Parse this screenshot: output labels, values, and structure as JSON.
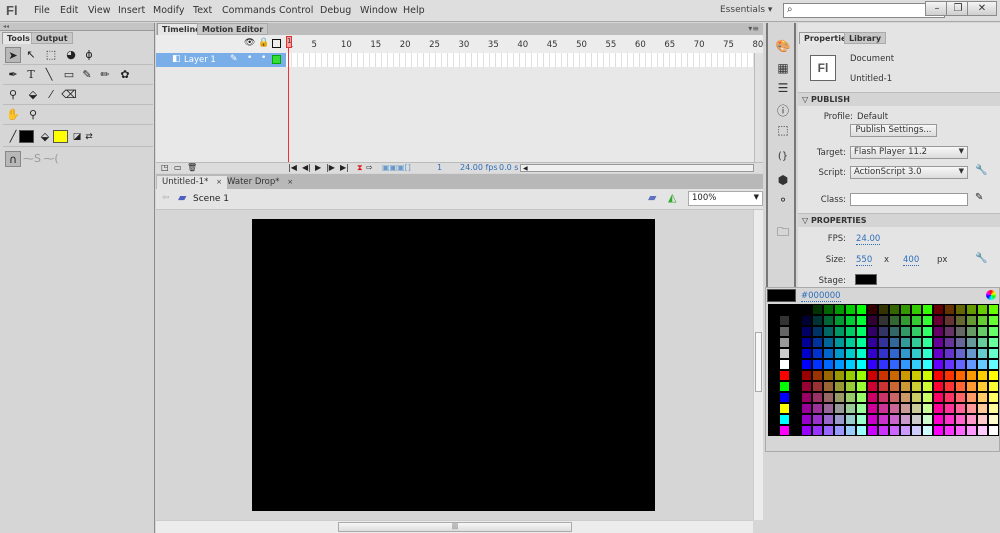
{
  "app": {
    "logo": "Fl"
  },
  "menubar": {
    "items": [
      "File",
      "Edit",
      "View",
      "Insert",
      "Modify",
      "Text",
      "Commands",
      "Control",
      "Debug",
      "Window",
      "Help"
    ],
    "workspace": "Essentials ▾",
    "search_placeholder": "",
    "window_buttons": [
      "–",
      "❐",
      "✕"
    ]
  },
  "tools_panel": {
    "tabs": [
      "Tools",
      "Output"
    ],
    "rows": [
      [
        "▲",
        "↖",
        "⬚",
        "◔",
        "⌇"
      ],
      [
        "✒",
        "T",
        "╲",
        "▭",
        "✏",
        "🖌",
        "✿"
      ],
      [
        "✂",
        "⬙",
        "✎",
        "⌫"
      ],
      [
        "✋",
        "🔍"
      ],
      [
        "stroke-color",
        "fill-color"
      ],
      [
        "snap",
        "smooth",
        "straighten"
      ]
    ],
    "stroke_color": "#000000",
    "fill_color": "#ffff00"
  },
  "timeline": {
    "tabs": [
      "Timeline",
      "Motion Editor"
    ],
    "frame_numbers": [
      "1",
      "5",
      "10",
      "15",
      "20",
      "25",
      "30",
      "35",
      "40",
      "45",
      "50",
      "55",
      "60",
      "65",
      "70",
      "75",
      "80"
    ],
    "layer_name": "Layer 1",
    "current_frame": "1",
    "fps": "24.00 fps",
    "time": "0.0 s"
  },
  "documents": {
    "tabs": [
      {
        "label": "Untitled-1*",
        "close": "×"
      },
      {
        "label": "Water Drop*",
        "close": "×"
      }
    ],
    "scene": "Scene 1",
    "zoom": "100%"
  },
  "properties": {
    "tabs": [
      "Properties",
      "Library"
    ],
    "doc_type": "Document",
    "doc_name": "Untitled-1",
    "publish_header": "PUBLISH",
    "profile_label": "Profile:",
    "profile_value": "Default",
    "publish_settings": "Publish Settings...",
    "target_label": "Target:",
    "target_value": "Flash Player 11.2",
    "script_label": "Script:",
    "script_value": "ActionScript 3.0",
    "class_label": "Class:",
    "class_value": "",
    "properties_header": "PROPERTIES",
    "fps_label": "FPS:",
    "fps_value": "24.00",
    "size_label": "Size:",
    "width": "550",
    "x": "x",
    "height": "400",
    "unit": "px",
    "stage_label": "Stage:",
    "stage_color": "#000000"
  },
  "swatch": {
    "hex": "#000000"
  }
}
